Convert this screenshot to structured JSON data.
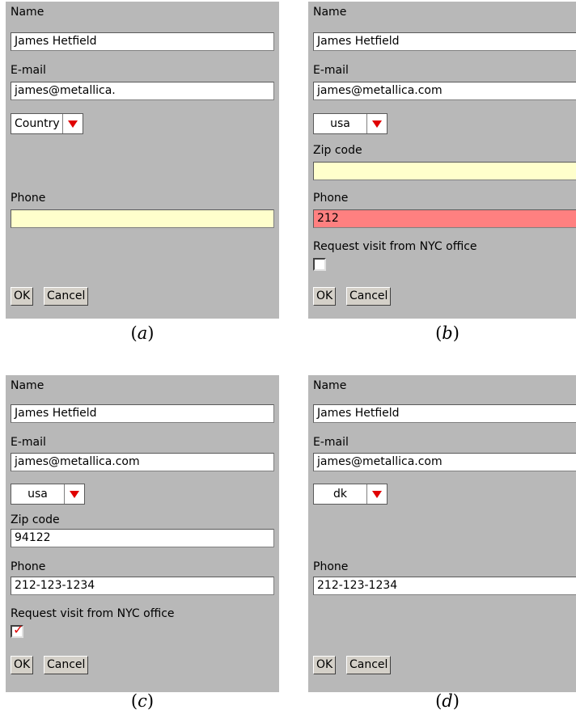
{
  "panels": [
    {
      "caption": "a",
      "name_label": "Name",
      "name_value": "James Hetfield",
      "email_label": "E-mail",
      "email_value": "james@metallica.",
      "country_value": "Country",
      "phone_label": "Phone",
      "phone_value": "",
      "phone_bg": "#ffffcc",
      "ok_label": "OK",
      "cancel_label": "Cancel"
    },
    {
      "caption": "b",
      "name_label": "Name",
      "name_value": "James Hetfield",
      "email_label": "E-mail",
      "email_value": "james@metallica.com",
      "country_value": "usa",
      "zip_label": "Zip code",
      "zip_value": "",
      "zip_bg": "#ffffcc",
      "phone_label": "Phone",
      "phone_value": "212",
      "phone_bg": "#ff8080",
      "visit_label": "Request visit from NYC office",
      "visit_checked": false,
      "ok_label": "OK",
      "cancel_label": "Cancel"
    },
    {
      "caption": "c",
      "name_label": "Name",
      "name_value": "James Hetfield",
      "email_label": "E-mail",
      "email_value": "james@metallica.com",
      "country_value": "usa",
      "zip_label": "Zip code",
      "zip_value": "94122",
      "phone_label": "Phone",
      "phone_value": "212-123-1234",
      "visit_label": "Request visit from NYC office",
      "visit_checked": true,
      "ok_label": "OK",
      "cancel_label": "Cancel"
    },
    {
      "caption": "d",
      "name_label": "Name",
      "name_value": "James Hetfield",
      "email_label": "E-mail",
      "email_value": "james@metallica.com",
      "country_value": "dk",
      "phone_label": "Phone",
      "phone_value": "212-123-1234",
      "ok_label": "OK",
      "cancel_label": "Cancel"
    }
  ],
  "colors": {
    "panel_bg": "#b8b8b8",
    "required_empty": "#ffffcc",
    "invalid": "#ff8080",
    "dropdown_arrow": "#e00000",
    "checkmark": "#e00000"
  },
  "icons": {
    "dropdown": "red-triangle-down-icon",
    "check": "red-checkmark-icon"
  }
}
